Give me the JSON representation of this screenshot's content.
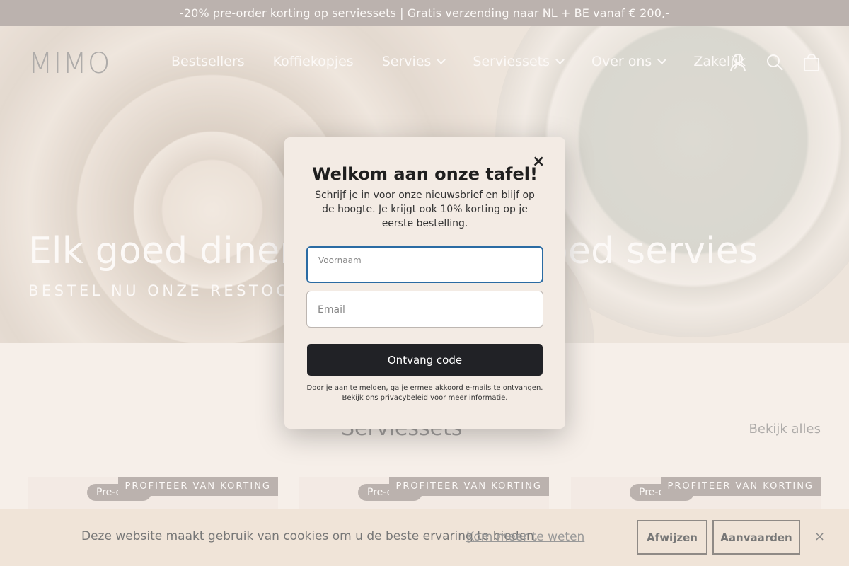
{
  "announcement": "-20% pre-order korting op serviessets | Gratis verzending naar NL + BE vanaf € 200,-",
  "logo": "MIMO",
  "nav": {
    "items": [
      {
        "label": "Bestsellers",
        "dropdown": false
      },
      {
        "label": "Koffiekopjes",
        "dropdown": false
      },
      {
        "label": "Servies",
        "dropdown": true
      },
      {
        "label": "Serviessets",
        "dropdown": true
      },
      {
        "label": "Over ons",
        "dropdown": true
      },
      {
        "label": "Zakelijk",
        "dropdown": false
      }
    ]
  },
  "header_icons": [
    "account-icon",
    "search-icon",
    "cart-icon"
  ],
  "hero": {
    "title": "Elk goed diner begint met goed servies",
    "subtitle": "BESTEL NU ONZE RESTOCK IN PRE-ORDER"
  },
  "section": {
    "title": "Serviessets",
    "view_all": "Bekijk alles"
  },
  "products": [
    {
      "badge_preorder": "Pre-order",
      "badge_discount": "PROFITEER VAN KORTING"
    },
    {
      "badge_preorder": "Pre-order",
      "badge_discount": "PROFITEER VAN KORTING"
    },
    {
      "badge_preorder": "Pre-order",
      "badge_discount": "PROFITEER VAN KORTING"
    }
  ],
  "modal": {
    "close": "×",
    "title": "Welkom aan onze tafel!",
    "description": "Schrijf je in voor onze nieuwsbrief en blijf op de hoogte. Je krijgt ook 10% korting op je eerste bestelling.",
    "first_name_label": "Voornaam",
    "first_name_value": "",
    "email_label": "Email",
    "email_value": "",
    "submit": "Ontvang code",
    "fine_print_1": "Door je aan te melden, ga je ermee akkoord e-mails te ontvangen.",
    "fine_print_2": "Bekijk ons privacybeleid voor meer informatie."
  },
  "cookie": {
    "text": "Deze website maakt gebruik van cookies om u de beste ervaring te bieden.",
    "link": "Kom meer te weten",
    "decline": "Afwijzen",
    "accept": "Aanvaarden",
    "close": "×"
  },
  "colors": {
    "announcement_bg": "#9b9390",
    "button_dark": "#212226",
    "focus_border": "#2a6ba3",
    "page_bg": "#f6f0ea"
  }
}
